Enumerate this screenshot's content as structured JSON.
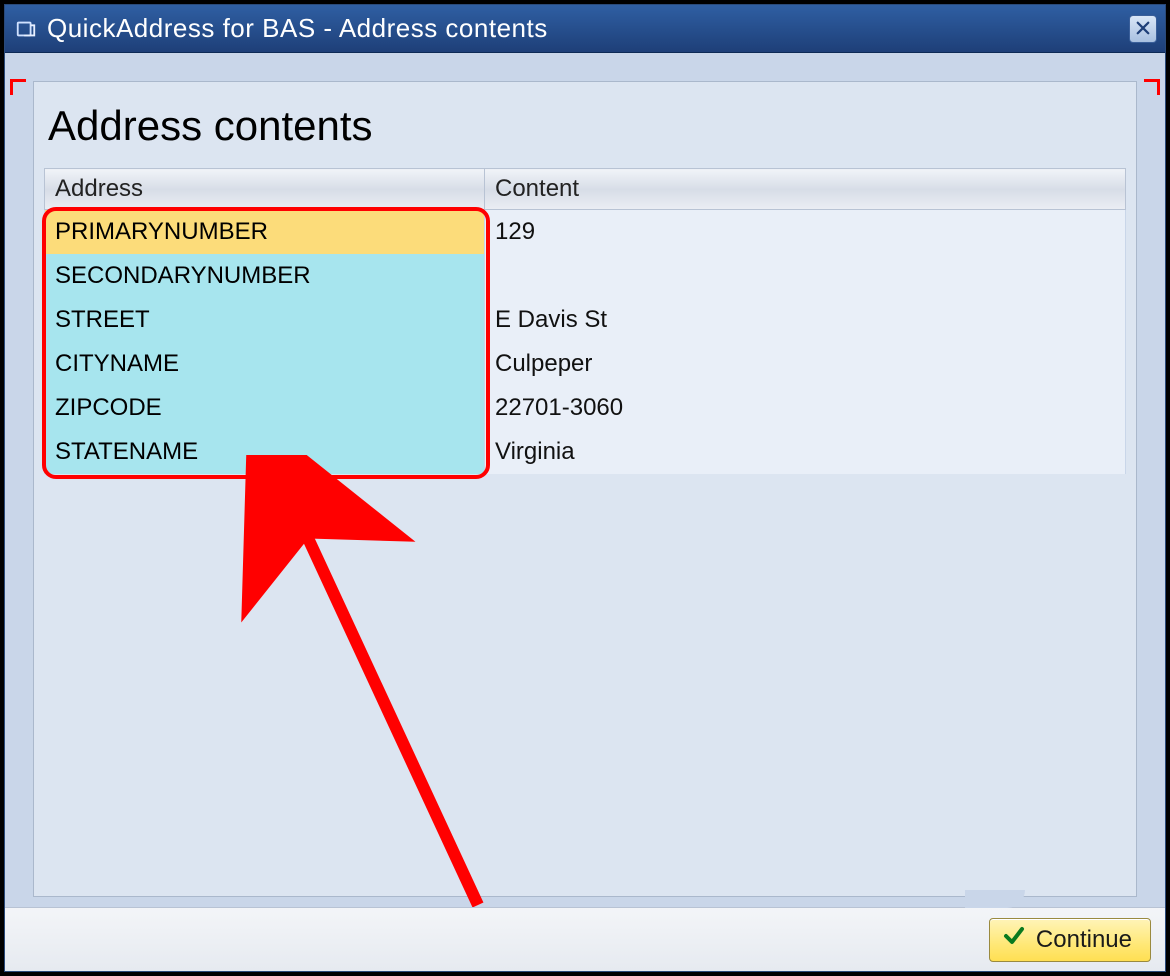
{
  "window": {
    "title": "QuickAddress for BAS - Address contents"
  },
  "main": {
    "heading": "Address contents",
    "columns": {
      "address": "Address",
      "content": "Content"
    },
    "rows": [
      {
        "address": "PRIMARYNUMBER",
        "content": "129",
        "selected": true
      },
      {
        "address": "SECONDARYNUMBER",
        "content": "",
        "selected": false
      },
      {
        "address": "STREET",
        "content": "E Davis St",
        "selected": false
      },
      {
        "address": "CITYNAME",
        "content": "Culpeper",
        "selected": false
      },
      {
        "address": "ZIPCODE",
        "content": "22701-3060",
        "selected": false
      },
      {
        "address": "STATENAME",
        "content": "Virginia",
        "selected": false
      }
    ]
  },
  "footer": {
    "continue_label": "Continue"
  },
  "colors": {
    "title_bg": "#1e3f78",
    "panel_bg": "#dce5f1",
    "selected_row": "#fcdc7a",
    "key_cell": "#a7e5ee",
    "annotation": "#ff0000",
    "button_bg": "#ffe877"
  }
}
